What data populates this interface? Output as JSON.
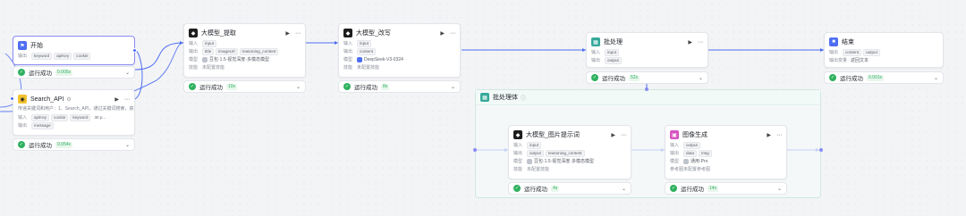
{
  "canvas": {
    "edge_color": "#4e6ef2",
    "success_color": "#2fb15f"
  },
  "labels": {
    "input": "输入",
    "output": "输出",
    "model": "模型",
    "skill": "技能",
    "output_variable": "输出变量",
    "reference_image": "参考图",
    "success": "运行成功"
  },
  "nodes": {
    "start": {
      "title": "开始",
      "icon": "flag-icon",
      "outputs": [
        "keyword",
        "apiKey",
        "cookie"
      ],
      "status_time": "0.005s"
    },
    "search": {
      "title": "Search_API",
      "icon": "search-plugin-icon",
      "description": "传递关键词和用户：1、Search_API，通过关键词搜索，获取...",
      "inputs": [
        "apiKey",
        "cookie",
        "keyword",
        "30 p..."
      ],
      "outputs": [
        "message"
      ],
      "status_time": "0.054s"
    },
    "llm_extract": {
      "title": "大模型_提取",
      "icon": "model-icon",
      "inputs": [
        "input"
      ],
      "outputs": [
        "title",
        "imageUrl",
        "reasoning_content"
      ],
      "model": "豆包·1.5·视觉深度·多模态模型",
      "skill": "未配置技能",
      "status_time": "10s"
    },
    "llm_rewrite": {
      "title": "大模型_改写",
      "icon": "model-icon",
      "inputs": [
        "input"
      ],
      "outputs": [
        "content"
      ],
      "model": "DeepSeek-V3-0324",
      "skill": "未配置技能",
      "status_time": "8s"
    },
    "batch": {
      "title": "批处理",
      "icon": "batch-icon",
      "inputs": [
        "input"
      ],
      "outputs": [
        "output"
      ],
      "status_time": "52s"
    },
    "end": {
      "title": "结束",
      "icon": "end-icon",
      "outputs": [
        "content",
        "output"
      ],
      "output_variable_value": "返回文本",
      "status_time": "0.001s"
    },
    "batch_body": {
      "title": "批处理体",
      "icon": "batch-body-icon"
    },
    "llm_prompt": {
      "title": "大模型_图片提示词",
      "icon": "model-icon",
      "inputs": [
        "input"
      ],
      "outputs": [
        "output",
        "reasoning_content"
      ],
      "model": "豆包·1.5·视觉深度·多模态模型",
      "skill": "未配置技能",
      "status_time": "4s"
    },
    "image_gen": {
      "title": "图像生成",
      "icon": "image-gen-icon",
      "inputs": [
        "output"
      ],
      "outputs": [
        "data",
        "msg"
      ],
      "model": "通用-Pro",
      "reference": "未配置参考图",
      "status_time": "14s"
    }
  }
}
